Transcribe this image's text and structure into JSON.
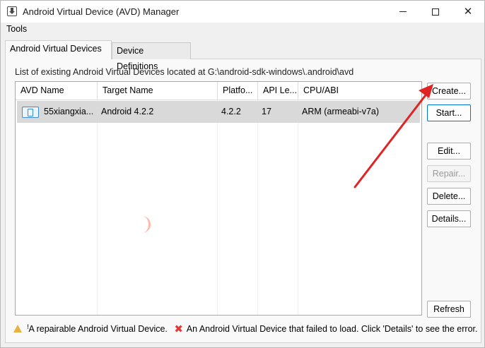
{
  "window": {
    "title": "Android Virtual Device (AVD) Manager"
  },
  "menu": {
    "tools": "Tools"
  },
  "tabs": [
    {
      "label": "Android Virtual Devices"
    },
    {
      "label": "Device Definitions"
    }
  ],
  "list_label": "List of existing Android Virtual Devices located at G:\\android-sdk-windows\\.android\\avd",
  "table": {
    "columns": [
      "AVD Name",
      "Target Name",
      "Platfo...",
      "API Le...",
      "CPU/ABI"
    ],
    "rows": [
      {
        "avd_name": "55xiangxia...",
        "target": "Android 4.2.2",
        "platform": "4.2.2",
        "api": "17",
        "cpu": "ARM (armeabi-v7a)"
      }
    ]
  },
  "buttons": {
    "create": "Create...",
    "start": "Start...",
    "edit": "Edit...",
    "repair": "Repair...",
    "delete": "Delete...",
    "details": "Details...",
    "refresh": "Refresh"
  },
  "footer": {
    "warning_text": "A repairable Android Virtual Device.",
    "error_text": "An Android Virtual Device that failed to load. Click 'Details' to see the error."
  },
  "annotation": {
    "arrow_color": "#e02424"
  }
}
